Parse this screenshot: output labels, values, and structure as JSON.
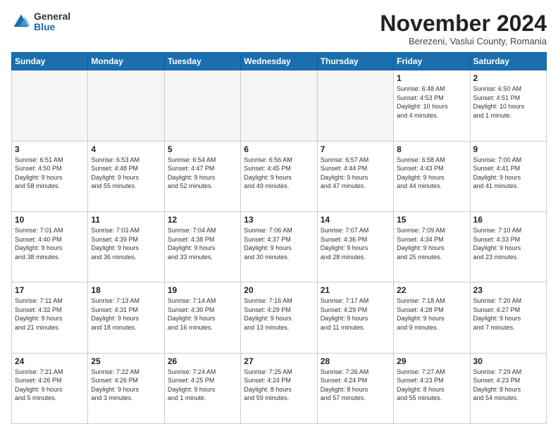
{
  "logo": {
    "general": "General",
    "blue": "Blue"
  },
  "header": {
    "month": "November 2024",
    "location": "Berezeni, Vaslui County, Romania"
  },
  "weekdays": [
    "Sunday",
    "Monday",
    "Tuesday",
    "Wednesday",
    "Thursday",
    "Friday",
    "Saturday"
  ],
  "weeks": [
    [
      {
        "day": "",
        "info": ""
      },
      {
        "day": "",
        "info": ""
      },
      {
        "day": "",
        "info": ""
      },
      {
        "day": "",
        "info": ""
      },
      {
        "day": "",
        "info": ""
      },
      {
        "day": "1",
        "info": "Sunrise: 6:48 AM\nSunset: 4:53 PM\nDaylight: 10 hours\nand 4 minutes."
      },
      {
        "day": "2",
        "info": "Sunrise: 6:50 AM\nSunset: 4:51 PM\nDaylight: 10 hours\nand 1 minute."
      }
    ],
    [
      {
        "day": "3",
        "info": "Sunrise: 6:51 AM\nSunset: 4:50 PM\nDaylight: 9 hours\nand 58 minutes."
      },
      {
        "day": "4",
        "info": "Sunrise: 6:53 AM\nSunset: 4:48 PM\nDaylight: 9 hours\nand 55 minutes."
      },
      {
        "day": "5",
        "info": "Sunrise: 6:54 AM\nSunset: 4:47 PM\nDaylight: 9 hours\nand 52 minutes."
      },
      {
        "day": "6",
        "info": "Sunrise: 6:56 AM\nSunset: 4:45 PM\nDaylight: 9 hours\nand 49 minutes."
      },
      {
        "day": "7",
        "info": "Sunrise: 6:57 AM\nSunset: 4:44 PM\nDaylight: 9 hours\nand 47 minutes."
      },
      {
        "day": "8",
        "info": "Sunrise: 6:58 AM\nSunset: 4:43 PM\nDaylight: 9 hours\nand 44 minutes."
      },
      {
        "day": "9",
        "info": "Sunrise: 7:00 AM\nSunset: 4:41 PM\nDaylight: 9 hours\nand 41 minutes."
      }
    ],
    [
      {
        "day": "10",
        "info": "Sunrise: 7:01 AM\nSunset: 4:40 PM\nDaylight: 9 hours\nand 38 minutes."
      },
      {
        "day": "11",
        "info": "Sunrise: 7:03 AM\nSunset: 4:39 PM\nDaylight: 9 hours\nand 36 minutes."
      },
      {
        "day": "12",
        "info": "Sunrise: 7:04 AM\nSunset: 4:38 PM\nDaylight: 9 hours\nand 33 minutes."
      },
      {
        "day": "13",
        "info": "Sunrise: 7:06 AM\nSunset: 4:37 PM\nDaylight: 9 hours\nand 30 minutes."
      },
      {
        "day": "14",
        "info": "Sunrise: 7:07 AM\nSunset: 4:36 PM\nDaylight: 9 hours\nand 28 minutes."
      },
      {
        "day": "15",
        "info": "Sunrise: 7:09 AM\nSunset: 4:34 PM\nDaylight: 9 hours\nand 25 minutes."
      },
      {
        "day": "16",
        "info": "Sunrise: 7:10 AM\nSunset: 4:33 PM\nDaylight: 9 hours\nand 23 minutes."
      }
    ],
    [
      {
        "day": "17",
        "info": "Sunrise: 7:11 AM\nSunset: 4:32 PM\nDaylight: 9 hours\nand 21 minutes."
      },
      {
        "day": "18",
        "info": "Sunrise: 7:13 AM\nSunset: 4:31 PM\nDaylight: 9 hours\nand 18 minutes."
      },
      {
        "day": "19",
        "info": "Sunrise: 7:14 AM\nSunset: 4:30 PM\nDaylight: 9 hours\nand 16 minutes."
      },
      {
        "day": "20",
        "info": "Sunrise: 7:16 AM\nSunset: 4:29 PM\nDaylight: 9 hours\nand 13 minutes."
      },
      {
        "day": "21",
        "info": "Sunrise: 7:17 AM\nSunset: 4:29 PM\nDaylight: 9 hours\nand 11 minutes."
      },
      {
        "day": "22",
        "info": "Sunrise: 7:18 AM\nSunset: 4:28 PM\nDaylight: 9 hours\nand 9 minutes."
      },
      {
        "day": "23",
        "info": "Sunrise: 7:20 AM\nSunset: 4:27 PM\nDaylight: 9 hours\nand 7 minutes."
      }
    ],
    [
      {
        "day": "24",
        "info": "Sunrise: 7:21 AM\nSunset: 4:26 PM\nDaylight: 9 hours\nand 5 minutes."
      },
      {
        "day": "25",
        "info": "Sunrise: 7:22 AM\nSunset: 4:26 PM\nDaylight: 9 hours\nand 3 minutes."
      },
      {
        "day": "26",
        "info": "Sunrise: 7:24 AM\nSunset: 4:25 PM\nDaylight: 9 hours\nand 1 minute."
      },
      {
        "day": "27",
        "info": "Sunrise: 7:25 AM\nSunset: 4:24 PM\nDaylight: 8 hours\nand 59 minutes."
      },
      {
        "day": "28",
        "info": "Sunrise: 7:26 AM\nSunset: 4:24 PM\nDaylight: 8 hours\nand 57 minutes."
      },
      {
        "day": "29",
        "info": "Sunrise: 7:27 AM\nSunset: 4:23 PM\nDaylight: 8 hours\nand 55 minutes."
      },
      {
        "day": "30",
        "info": "Sunrise: 7:29 AM\nSunset: 4:23 PM\nDaylight: 8 hours\nand 54 minutes."
      }
    ]
  ]
}
